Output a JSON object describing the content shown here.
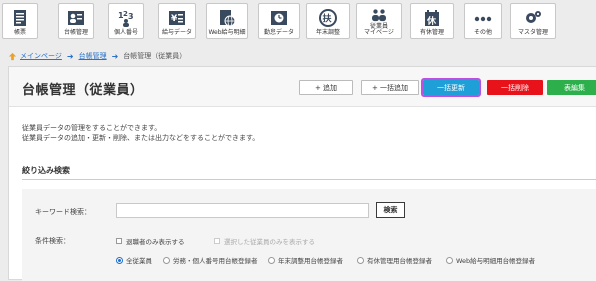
{
  "toolbar": {
    "items": [
      {
        "label": "帳票",
        "icon": "report-icon"
      },
      {
        "label": "台帳管理",
        "icon": "ledger-icon"
      },
      {
        "label": "個人番号",
        "icon": "my-number-icon"
      },
      {
        "label": "給与データ",
        "icon": "salary-data-icon"
      },
      {
        "label": "Web給与明細",
        "icon": "web-payslip-icon"
      },
      {
        "label": "勤怠データ",
        "icon": "attendance-icon"
      },
      {
        "label": "年末調整",
        "icon": "year-end-icon"
      },
      {
        "label": "従業員",
        "label2": "マイページ",
        "icon": "employee-mypage-icon"
      },
      {
        "label": "有休管理",
        "icon": "paid-leave-icon"
      },
      {
        "label": "その他",
        "icon": "more-icon"
      },
      {
        "label": "マスタ管理",
        "icon": "master-settings-icon"
      }
    ]
  },
  "breadcrumb": {
    "home": "メインページ",
    "ledger": "台帳管理",
    "current": "台帳管理（従業員）"
  },
  "page": {
    "title": "台帳管理（従業員）",
    "add_label": "+ 追加",
    "bulk_add_label": "+ 一括追加",
    "bulk_update_label": "一括更新",
    "bulk_delete_label": "一括削除",
    "table_edit_label": "表編集",
    "desc_line1": "従業員データの管理をすることができます。",
    "desc_line2": "従業員データの追加・更新・削除、または出力などをすることができます。"
  },
  "filter": {
    "section_title": "絞り込み検索",
    "keyword_label": "キーワード検索：",
    "keyword_value": "",
    "search_button": "検索",
    "condition_label": "条件検索：",
    "retired_only": "退職者のみ表示する",
    "selected_only": "選択した従業員のみを表示する",
    "radios": [
      "全従業員",
      "労務・個人番号用台帳登録者",
      "年末調整用台帳登録者",
      "有休管理用台帳登録者",
      "Web給与明細用台帳登録者"
    ],
    "selected_radio": "全従業員"
  },
  "colors": {
    "accent_blue": "#1f9fd8",
    "danger_red": "#e8121b",
    "success_green": "#2db04b",
    "highlight_purple": "#c04fe0"
  }
}
